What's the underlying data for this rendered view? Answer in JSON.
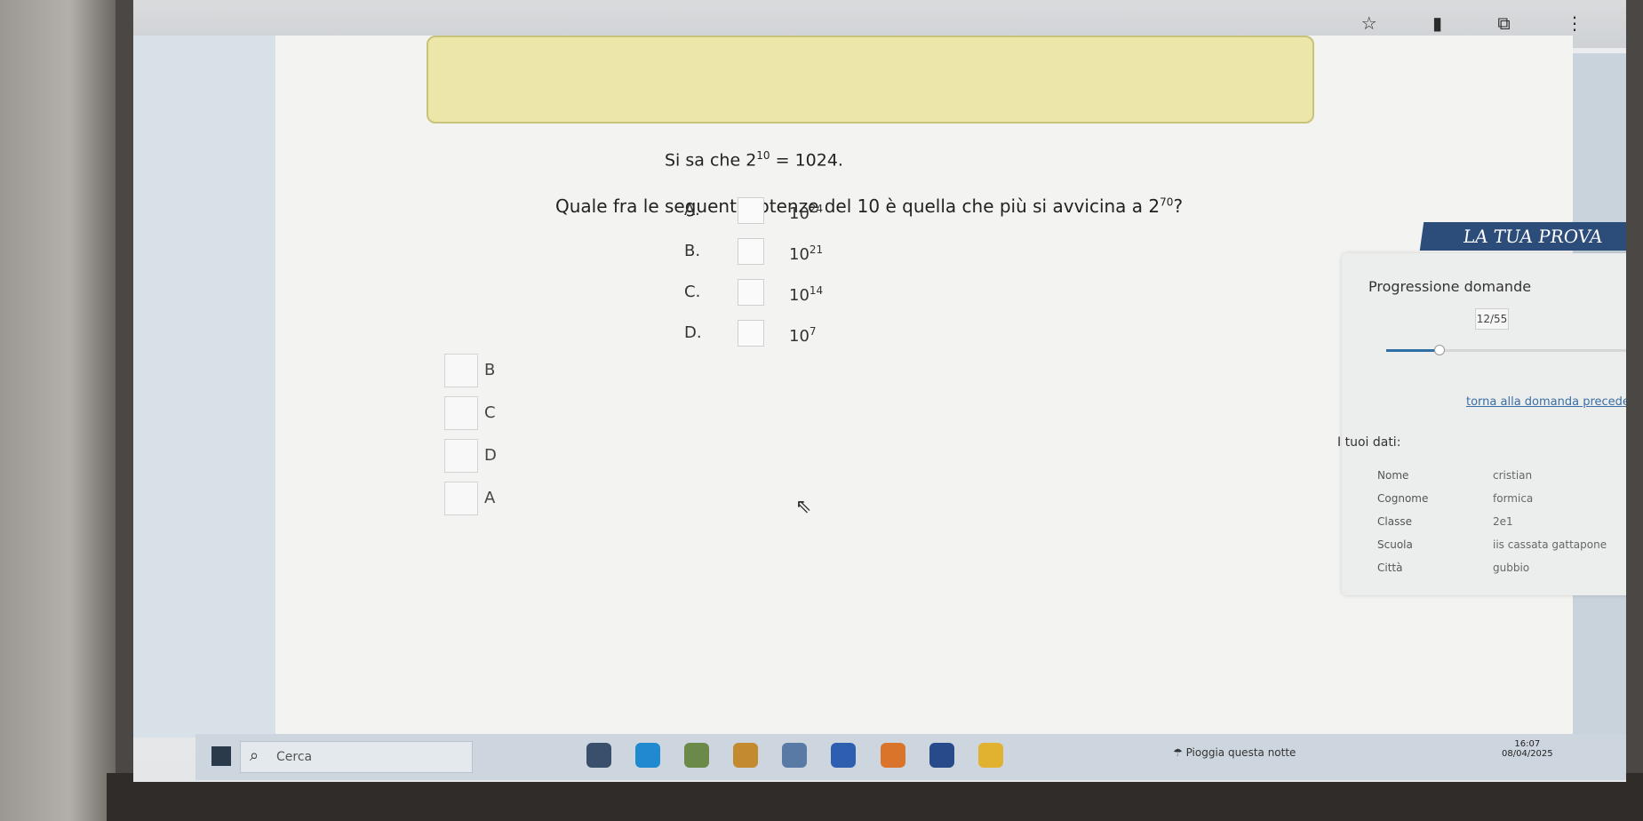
{
  "question": {
    "intro_text": "Si sa che",
    "intro_base": "2",
    "intro_exp": "10",
    "intro_result": "= 1024.",
    "main_text": "Quale fra le seguenti potenze del 10 è quella che più si avvicina a",
    "main_base": "2",
    "main_exp": "70",
    "main_end": "?"
  },
  "options": [
    {
      "letter": "A.",
      "base": "10",
      "exp": "24"
    },
    {
      "letter": "B.",
      "base": "10",
      "exp": "21"
    },
    {
      "letter": "C.",
      "base": "10",
      "exp": "14"
    },
    {
      "letter": "D.",
      "base": "10",
      "exp": "7"
    }
  ],
  "answer_choices": [
    "B",
    "C",
    "D",
    "A"
  ],
  "sidebar": {
    "banner": "LA TUA PROVA",
    "progress_title": "Progressione domande",
    "progress_count": "12/55",
    "progress_fraction": 0.22,
    "back_link": "torna alla domanda precedente",
    "data_title": "I tuoi dati:",
    "data": [
      {
        "key": "Nome",
        "value": "cristian"
      },
      {
        "key": "Cognome",
        "value": "formica"
      },
      {
        "key": "Classe",
        "value": "2e1"
      },
      {
        "key": "Scuola",
        "value": "iis cassata gattapone"
      },
      {
        "key": "Città",
        "value": "gubbio"
      }
    ]
  },
  "icons": {
    "scroll_up": "chevron-up-icon",
    "bookmark": "star-icon"
  },
  "taskbar": {
    "search_placeholder": "Cerca",
    "weather": "Pioggia questa notte",
    "time": "16:07",
    "date": "08/04/2025"
  },
  "colors": {
    "banner": "#2c4d7a",
    "link": "#3b6ea5",
    "highlight": "#ece7a8"
  }
}
